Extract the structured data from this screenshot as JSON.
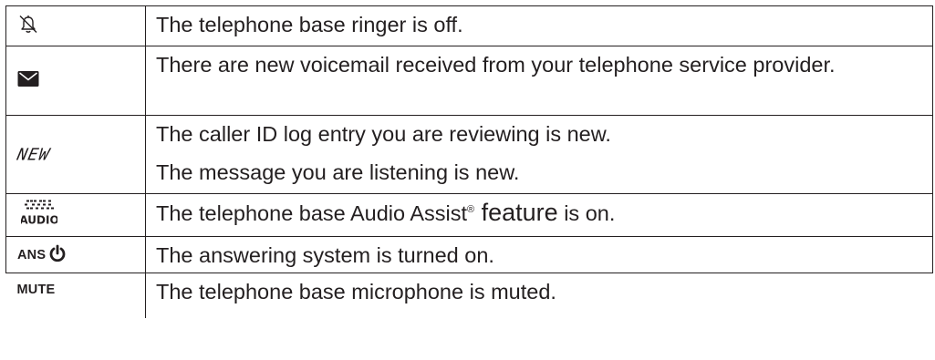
{
  "rows": [
    {
      "icon_name": "ringer-off-icon",
      "lines": [
        "The telephone base ringer is off."
      ]
    },
    {
      "icon_name": "envelope-icon",
      "lines": [
        "There are new voicemail received from your telephone service provider."
      ]
    },
    {
      "icon_label": "NEW",
      "lines": [
        "The caller ID log entry you are reviewing is new.",
        "The message you are listening is new."
      ]
    },
    {
      "icon_name": "audio-assist-icon",
      "icon_label": "AUDIO",
      "text_before": "The telephone base Audio Assist",
      "reg_mark": "®",
      "text_feature": " feature",
      "text_after": " is on."
    },
    {
      "icon_label": "ANS",
      "icon_name": "power-icon",
      "lines": [
        "The answering system is turned on."
      ]
    },
    {
      "icon_label": "MUTE",
      "lines": [
        "The telephone base microphone is muted."
      ]
    }
  ]
}
